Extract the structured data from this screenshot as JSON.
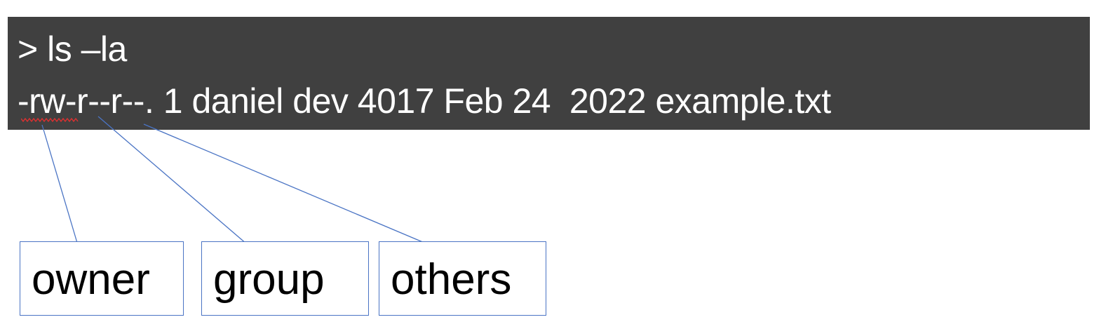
{
  "terminal": {
    "command": "> ls –la",
    "output": "-rw-r--r--. 1 daniel dev 4017 Feb 24  2022 example.txt",
    "background": "#404040",
    "text_color": "#ffffff"
  },
  "labels": [
    {
      "id": "owner",
      "text": "owner"
    },
    {
      "id": "group",
      "text": "group"
    },
    {
      "id": "others",
      "text": "others"
    }
  ],
  "colors": {
    "connector": "#4a74c4",
    "box_border": "#4a74c4",
    "spellcheck": "#e03030"
  }
}
